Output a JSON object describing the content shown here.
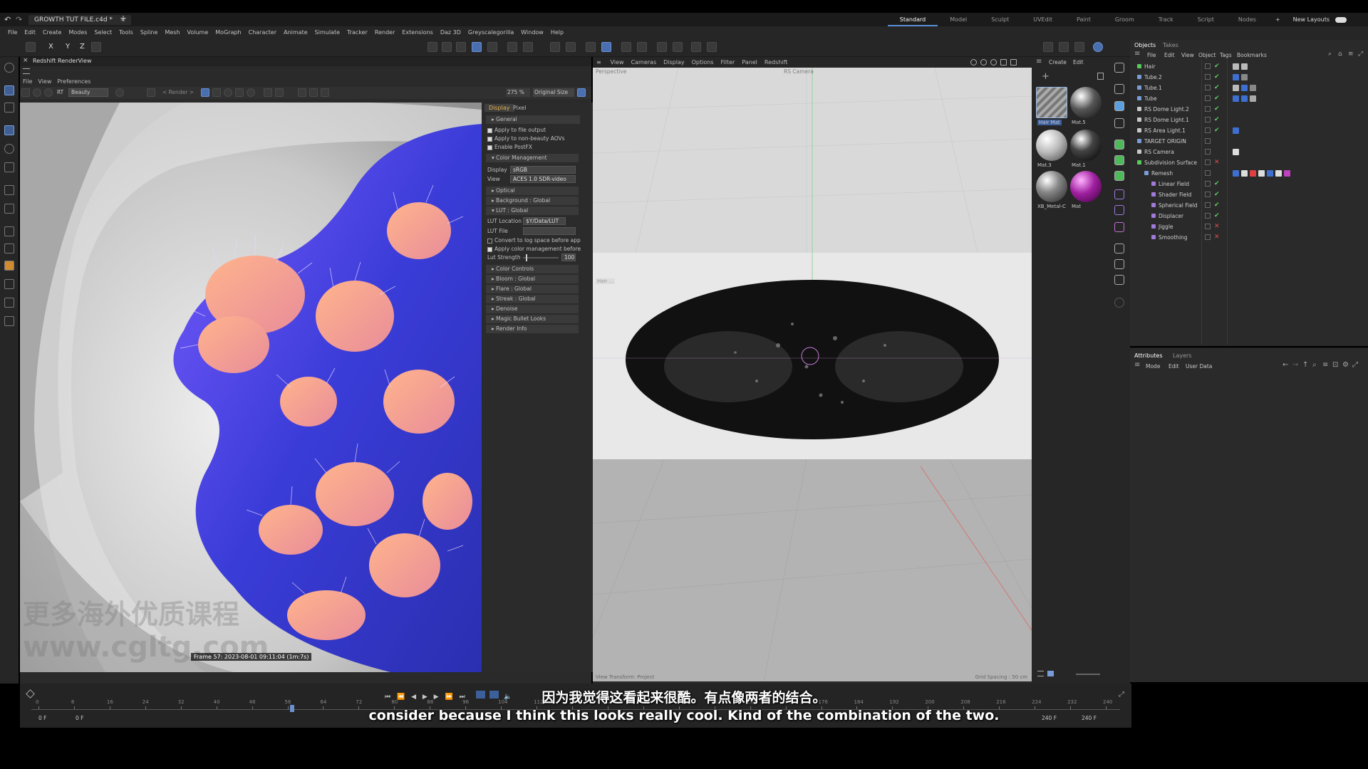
{
  "window": {
    "file_tab": "GROWTH TUT FILE.c4d *",
    "layouts": [
      "Standard",
      "Model",
      "Sculpt",
      "UVEdit",
      "Paint",
      "Groom",
      "Track",
      "Script",
      "Nodes"
    ],
    "active_layout": "Standard",
    "new_layouts": "New Layouts"
  },
  "menubar": [
    "File",
    "Edit",
    "Create",
    "Modes",
    "Select",
    "Tools",
    "Spline",
    "Mesh",
    "Volume",
    "MoGraph",
    "Character",
    "Animate",
    "Simulate",
    "Tracker",
    "Render",
    "Extensions",
    "Daz 3D",
    "Greyscalegorilla",
    "Window",
    "Help"
  ],
  "axis_buttons": [
    "X",
    "Y",
    "Z"
  ],
  "renderview": {
    "title": "Redshift RenderView",
    "menu": [
      "File",
      "View",
      "Preferences"
    ],
    "aov_label": "RT",
    "aov_value": "Beauty",
    "render_dropdown": "< Render >",
    "zoom": "275 %",
    "size_mode": "Original Size",
    "frame_info": "Frame  57:  2023-08-01  09:11:04  (1m:7s)",
    "watermark_cn": "更多海外优质课程",
    "watermark_url": "www.cgltg.com"
  },
  "rs_panel": {
    "tabs": [
      "Display",
      "Pixel"
    ],
    "general": "General",
    "apply_file": "Apply to file output",
    "apply_nonbeauty": "Apply to non-beauty AOVs",
    "enable_postfx": "Enable PostFX",
    "color_mgmt": "Color Management",
    "display_label": "Display",
    "display_value": "sRGB",
    "view_label": "View",
    "view_value": "ACES 1.0 SDR-video",
    "optical": "Optical",
    "background": "Background : Global",
    "lut": "LUT : Global",
    "lut_location_label": "LUT Location",
    "lut_location_value": "$Y/Data/LUT",
    "lut_file_label": "LUT File",
    "convert_log": "Convert to log space before app",
    "apply_color_mgmt": "Apply color management before",
    "lut_strength_label": "Lut Strength",
    "lut_strength_value": "100",
    "color_controls": "Color Controls",
    "bloom": "Bloom : Global",
    "flare": "Flare : Global",
    "streak": "Streak : Global",
    "denoise": "Denoise",
    "magic_bullet": "Magic Bullet Looks",
    "render_info": "Render Info"
  },
  "viewport": {
    "menu": [
      "View",
      "Cameras",
      "Display",
      "Options",
      "Filter",
      "Panel",
      "Redshift"
    ],
    "perspective": "Perspective",
    "camera": "RS Camera",
    "view_transform": "View Transform: Project",
    "grid_spacing": "Grid Spacing : 50 cm",
    "hair_label": "Hair ..."
  },
  "materials": {
    "menu": [
      "Create",
      "Edit"
    ],
    "items": [
      "Hair Mat",
      "Mat.5",
      "Mat.3",
      "Mat.1",
      "XB_Metal-C",
      "Mat"
    ]
  },
  "objects": {
    "tabs": [
      "Objects",
      "Takes"
    ],
    "menu": [
      "File",
      "Edit",
      "View",
      "Object",
      "Tags",
      "Bookmarks"
    ],
    "rows": [
      {
        "name": "Hair",
        "indent": 0,
        "state": "check"
      },
      {
        "name": "Tube.2",
        "indent": 0,
        "state": "check"
      },
      {
        "name": "Tube.1",
        "indent": 0,
        "state": "check"
      },
      {
        "name": "Tube",
        "indent": 0,
        "state": "check"
      },
      {
        "name": "RS Dome Light.2",
        "indent": 0,
        "state": "check"
      },
      {
        "name": "RS Dome Light.1",
        "indent": 0,
        "state": "check"
      },
      {
        "name": "RS Area Light.1",
        "indent": 0,
        "state": "check"
      },
      {
        "name": "TARGET ORIGIN",
        "indent": 0,
        "state": "none"
      },
      {
        "name": "RS Camera",
        "indent": 0,
        "state": "none"
      },
      {
        "name": "Subdivision Surface",
        "indent": 0,
        "state": "x"
      },
      {
        "name": "Remesh",
        "indent": 1,
        "state": "none"
      },
      {
        "name": "Linear Field",
        "indent": 2,
        "state": "check"
      },
      {
        "name": "Shader Field",
        "indent": 2,
        "state": "check"
      },
      {
        "name": "Spherical Field",
        "indent": 2,
        "state": "check"
      },
      {
        "name": "Displacer",
        "indent": 2,
        "state": "check"
      },
      {
        "name": "Jiggle",
        "indent": 2,
        "state": "x"
      },
      {
        "name": "Smoothing",
        "indent": 2,
        "state": "x"
      }
    ]
  },
  "attributes": {
    "tabs": [
      "Attributes",
      "Layers"
    ],
    "menu": [
      "Mode",
      "Edit",
      "User Data"
    ]
  },
  "timeline": {
    "ticks": [
      "0",
      "8",
      "16",
      "24",
      "32",
      "40",
      "48",
      "56",
      "64",
      "72",
      "80",
      "88",
      "96",
      "104",
      "112",
      "120",
      "128",
      "136",
      "144",
      "152",
      "160",
      "168",
      "176",
      "184",
      "192",
      "200",
      "208",
      "216",
      "224",
      "232",
      "240"
    ],
    "current_frame": 57,
    "start": "0 F",
    "start2": "0 F",
    "end": "240 F",
    "end2": "240 F"
  },
  "subtitles": {
    "zh": "因为我觉得这看起来很酷。有点像两者的结合。",
    "en": "consider because I think this looks really cool. Kind of the combination of the two."
  }
}
